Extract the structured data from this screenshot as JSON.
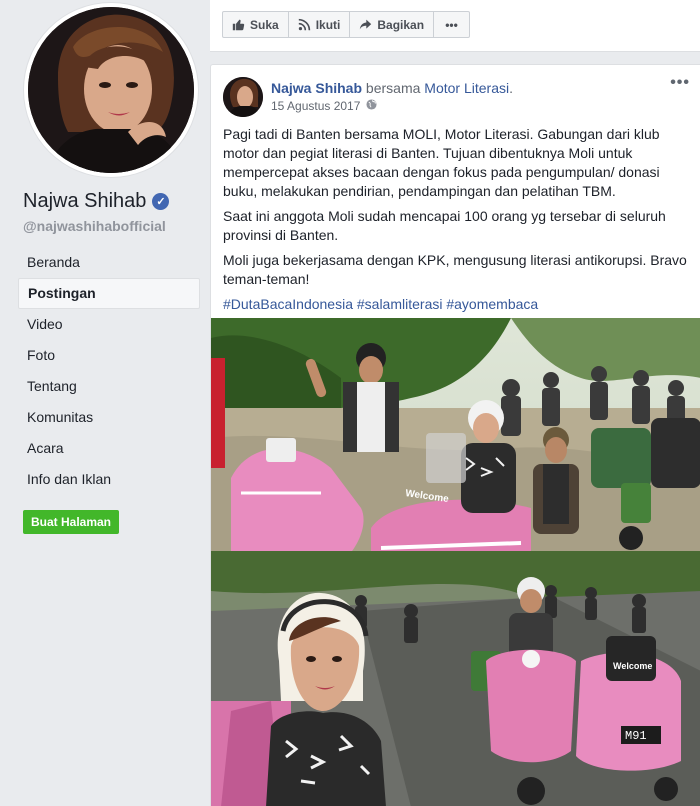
{
  "profile": {
    "name": "Najwa Shihab",
    "handle": "@najwashihabofficial"
  },
  "nav": [
    {
      "label": "Beranda",
      "active": false
    },
    {
      "label": "Postingan",
      "active": true
    },
    {
      "label": "Video",
      "active": false
    },
    {
      "label": "Foto",
      "active": false
    },
    {
      "label": "Tentang",
      "active": false
    },
    {
      "label": "Komunitas",
      "active": false
    },
    {
      "label": "Acara",
      "active": false
    },
    {
      "label": "Info dan Iklan",
      "active": false
    }
  ],
  "create_page_label": "Buat Halaman",
  "actions": {
    "like": "Suka",
    "follow": "Ikuti",
    "share": "Bagikan"
  },
  "post": {
    "author": "Najwa Shihab",
    "with_text": "bersama",
    "with_page": "Motor Literasi",
    "date": "15 Agustus 2017",
    "paragraphs": [
      "Pagi tadi di Banten bersama MOLI, Motor Literasi. Gabungan dari klub motor dan pegiat literasi di Banten. Tujuan dibentuknya Moli untuk mempercepat akses bacaan dengan fokus pada pengumpulan/ donasi buku, melakukan pendirian, pendampingan dan pelatihan TBM.",
      "Saat ini anggota Moli sudah mencapai 100 orang yg tersebar di seluruh provinsi di Banten.",
      "Moli juga bekerjasama dengan KPK, mengusung literasi antikorupsi. Bravo teman-teman!"
    ],
    "hashtags": "#DutaBacaIndonesia #salamliterasi #ayomembaca"
  },
  "colors": {
    "link": "#365899",
    "green": "#42b72a",
    "verified": "#4267b2",
    "scooter_pink": "#e27fb3"
  }
}
